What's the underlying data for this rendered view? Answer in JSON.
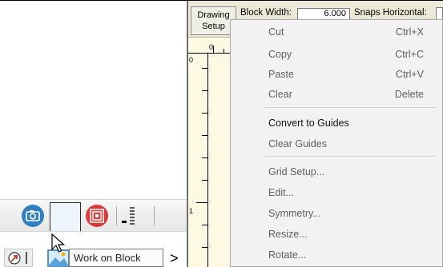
{
  "toolbar": {
    "tooltip": "Work on Block",
    "breadcrumb_arrow": ">",
    "icons": [
      "camera-icon",
      "block-edit-icon",
      "quilt-target-icon",
      "slider-level-icon",
      "arrow-tool-icon",
      "work-on-block-icon"
    ]
  },
  "drawing": {
    "setup_button": [
      "Drawing",
      "Setup"
    ],
    "block_width_label": "Block Width:",
    "block_width_value": "6.000",
    "snaps_label": "Snaps Horizontal:",
    "ruler": {
      "top_zero": "0",
      "left_zero": "0",
      "left_one": "1"
    }
  },
  "context_menu": {
    "items": [
      {
        "label": "Cut",
        "shortcut": "Ctrl+X"
      },
      {
        "label": "Copy",
        "shortcut": "Ctrl+C"
      },
      {
        "label": "Paste",
        "shortcut": "Ctrl+V"
      },
      {
        "label": "Clear",
        "shortcut": "Delete"
      },
      {
        "label": "Convert to Guides",
        "shortcut": ""
      },
      {
        "label": "Clear Guides",
        "shortcut": ""
      },
      {
        "label": "Grid Setup...",
        "shortcut": ""
      },
      {
        "label": "Edit...",
        "shortcut": ""
      },
      {
        "label": "Symmetry...",
        "shortcut": ""
      },
      {
        "label": "Resize...",
        "shortcut": ""
      },
      {
        "label": "Rotate...",
        "shortcut": ""
      }
    ]
  },
  "colors": {
    "drawing_bg": "#fdf9e3",
    "camera_blue": "#2f7fc1",
    "edit_orange": "#f0901e",
    "target_red": "#d93a3a"
  }
}
